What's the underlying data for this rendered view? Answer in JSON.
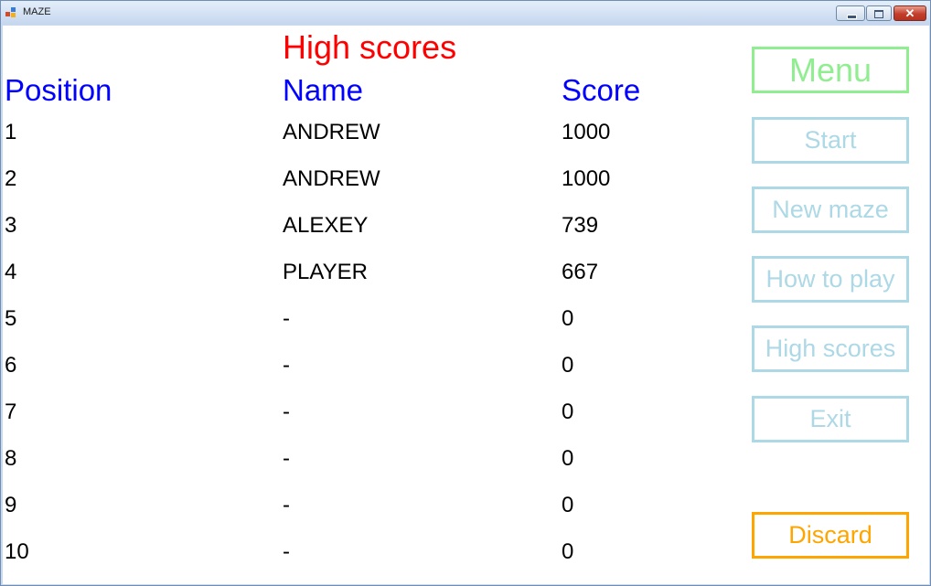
{
  "window": {
    "title": "MAZE"
  },
  "heading": "High scores",
  "columns": {
    "position": "Position",
    "name": "Name",
    "score": "Score"
  },
  "rows": [
    {
      "position": "1",
      "name": "ANDREW",
      "score": "1000"
    },
    {
      "position": "2",
      "name": "ANDREW",
      "score": "1000"
    },
    {
      "position": "3",
      "name": "ALEXEY",
      "score": "739"
    },
    {
      "position": "4",
      "name": "PLAYER",
      "score": "667"
    },
    {
      "position": "5",
      "name": "-",
      "score": "0"
    },
    {
      "position": "6",
      "name": "-",
      "score": "0"
    },
    {
      "position": "7",
      "name": "-",
      "score": "0"
    },
    {
      "position": "8",
      "name": "-",
      "score": "0"
    },
    {
      "position": "9",
      "name": "-",
      "score": "0"
    },
    {
      "position": "10",
      "name": "-",
      "score": "0"
    }
  ],
  "side_menu": {
    "menu": "Menu",
    "start": "Start",
    "new_maze": "New maze",
    "how_to_play": "How to play",
    "high_scores": "High scores",
    "exit": "Exit",
    "discard": "Discard"
  },
  "colors": {
    "heading": "#ff0000",
    "column_header": "#0000ff",
    "menu_button": "#90ee90",
    "nav_button": "#add8e6",
    "discard_button": "#ffa500"
  }
}
